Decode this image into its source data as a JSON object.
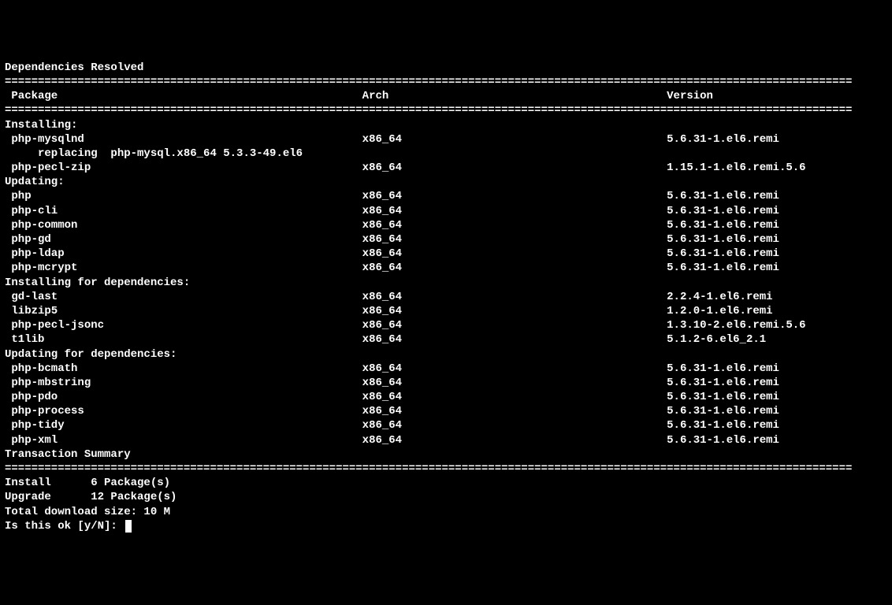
{
  "header": "Dependencies Resolved",
  "sep": "================================================================================================================================",
  "cols": {
    "pkg": "Package",
    "arch": "Arch",
    "ver": "Version"
  },
  "sections": {
    "installing": {
      "title": "Installing:",
      "rows": [
        {
          "pkg": "php-mysqlnd",
          "arch": "x86_64",
          "ver": "5.6.31-1.el6.remi",
          "replacing": "php-mysql.x86_64 5.3.3-49.el6"
        },
        {
          "pkg": "php-pecl-zip",
          "arch": "x86_64",
          "ver": "1.15.1-1.el6.remi.5.6"
        }
      ]
    },
    "updating": {
      "title": "Updating:",
      "rows": [
        {
          "pkg": "php",
          "arch": "x86_64",
          "ver": "5.6.31-1.el6.remi"
        },
        {
          "pkg": "php-cli",
          "arch": "x86_64",
          "ver": "5.6.31-1.el6.remi"
        },
        {
          "pkg": "php-common",
          "arch": "x86_64",
          "ver": "5.6.31-1.el6.remi"
        },
        {
          "pkg": "php-gd",
          "arch": "x86_64",
          "ver": "5.6.31-1.el6.remi"
        },
        {
          "pkg": "php-ldap",
          "arch": "x86_64",
          "ver": "5.6.31-1.el6.remi"
        },
        {
          "pkg": "php-mcrypt",
          "arch": "x86_64",
          "ver": "5.6.31-1.el6.remi"
        }
      ]
    },
    "installing_deps": {
      "title": "Installing for dependencies:",
      "rows": [
        {
          "pkg": "gd-last",
          "arch": "x86_64",
          "ver": "2.2.4-1.el6.remi"
        },
        {
          "pkg": "libzip5",
          "arch": "x86_64",
          "ver": "1.2.0-1.el6.remi"
        },
        {
          "pkg": "php-pecl-jsonc",
          "arch": "x86_64",
          "ver": "1.3.10-2.el6.remi.5.6"
        },
        {
          "pkg": "t1lib",
          "arch": "x86_64",
          "ver": "5.1.2-6.el6_2.1"
        }
      ]
    },
    "updating_deps": {
      "title": "Updating for dependencies:",
      "rows": [
        {
          "pkg": "php-bcmath",
          "arch": "x86_64",
          "ver": "5.6.31-1.el6.remi"
        },
        {
          "pkg": "php-mbstring",
          "arch": "x86_64",
          "ver": "5.6.31-1.el6.remi"
        },
        {
          "pkg": "php-pdo",
          "arch": "x86_64",
          "ver": "5.6.31-1.el6.remi"
        },
        {
          "pkg": "php-process",
          "arch": "x86_64",
          "ver": "5.6.31-1.el6.remi"
        },
        {
          "pkg": "php-tidy",
          "arch": "x86_64",
          "ver": "5.6.31-1.el6.remi"
        },
        {
          "pkg": "php-xml",
          "arch": "x86_64",
          "ver": "5.6.31-1.el6.remi"
        }
      ]
    }
  },
  "summary": {
    "title": "Transaction Summary",
    "install": {
      "label": "Install",
      "count": "6 Package(s)"
    },
    "upgrade": {
      "label": "Upgrade",
      "count": "12 Package(s)"
    },
    "download": "Total download size: 10 M",
    "prompt": "Is this ok [y/N]: "
  },
  "replacing_label": "replacing"
}
